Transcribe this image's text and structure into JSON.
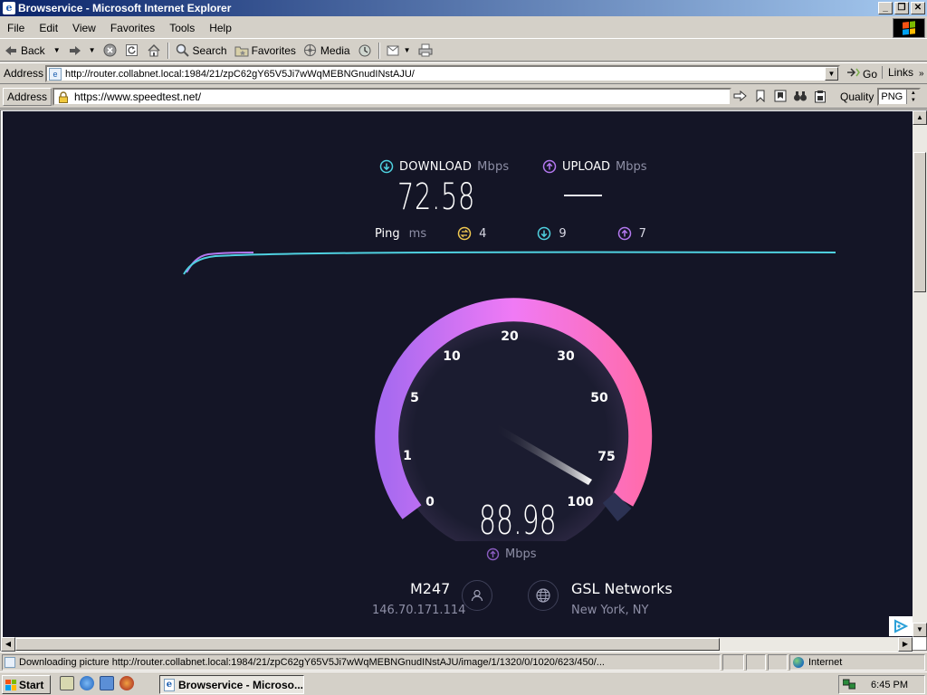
{
  "window": {
    "title": "Browservice - Microsoft Internet Explorer",
    "minimize": "_",
    "maximize": "❐",
    "close": "✕"
  },
  "menu": [
    "File",
    "Edit",
    "View",
    "Favorites",
    "Tools",
    "Help"
  ],
  "toolbar": {
    "back": "Back",
    "search": "Search",
    "favorites": "Favorites",
    "media": "Media"
  },
  "address_bar": {
    "label": "Address",
    "url": "http://router.collabnet.local:1984/21/zpC62gY65V5Ji7wWqMEBNGnudINstAJU/",
    "go": "Go",
    "links": "Links"
  },
  "inner_bar": {
    "label": "Address",
    "url": "https://www.speedtest.net/",
    "quality_label": "Quality",
    "quality_value": "PNG"
  },
  "speedtest": {
    "download_label": "DOWNLOAD",
    "download_unit": "Mbps",
    "download_value": "72.58",
    "upload_label": "UPLOAD",
    "upload_unit": "Mbps",
    "upload_value": "—",
    "ping_label": "Ping",
    "ping_unit": "ms",
    "ping_idle": "4",
    "ping_down": "9",
    "ping_up": "7",
    "gauge_labels": [
      "0",
      "1",
      "5",
      "10",
      "20",
      "30",
      "50",
      "75",
      "100"
    ],
    "current_value": "88.98",
    "current_unit": "Mbps",
    "isp_name": "M247",
    "isp_ip": "146.70.171.114",
    "server_name": "GSL Networks",
    "server_location": "New York, NY",
    "colors": {
      "background": "#141526",
      "download_accent": "#4fd1e0",
      "upload_accent": "#b478f0",
      "gauge_start": "#b46cf0",
      "gauge_end": "#ff6ec7"
    }
  },
  "status_bar": {
    "message": "Downloading picture http://router.collabnet.local:1984/21/zpC62gY65V5Ji7wWqMEBNGnudINstAJU/image/1/1320/0/1020/623/450/...",
    "zone": "Internet"
  },
  "taskbar": {
    "start": "Start",
    "task": "Browservice - Microso...",
    "clock": "6:45 PM"
  }
}
